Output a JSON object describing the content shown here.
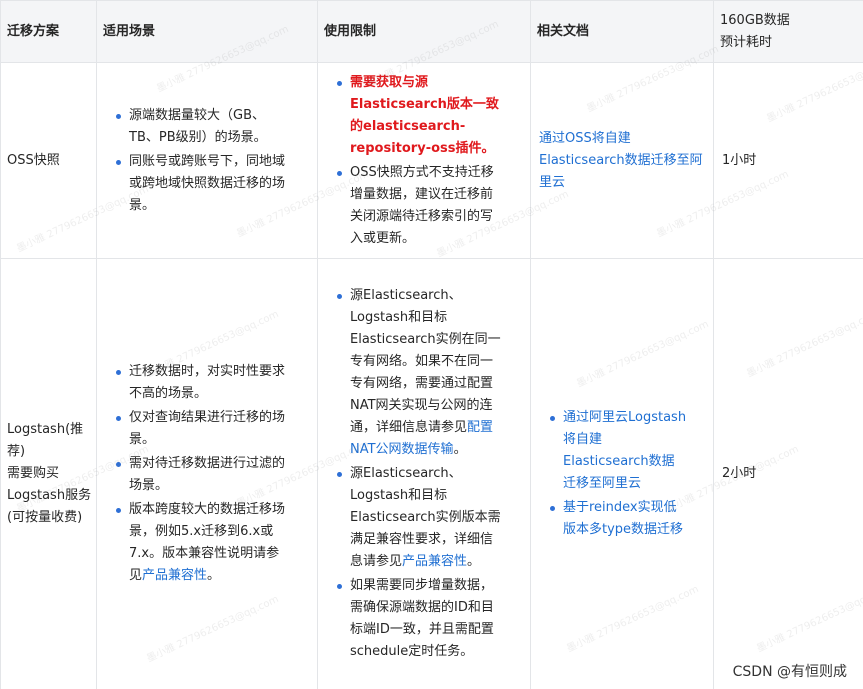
{
  "table": {
    "headers": {
      "scheme": "迁移方案",
      "scenario": "适用场景",
      "limits": "使用限制",
      "docs": "相关文档",
      "time_line1": "160GB数据",
      "time_line2": "预计耗时"
    },
    "rows": [
      {
        "scheme": "OSS快照",
        "scenarios": [
          "源端数据量较大（GB、TB、PB级别）的场景。",
          "同账号或跨账号下，同地域或跨地域快照数据迁移的场景。"
        ],
        "limits": [
          {
            "text": "需要获取与源Elasticsearch版本一致的elasticsearch-repository-oss插件。",
            "style": "red"
          },
          {
            "text": "OSS快照方式不支持迁移增量数据，建议在迁移前关闭源端待迁移索引的写入或更新。",
            "style": "normal"
          }
        ],
        "docs": "通过OSS将自建Elasticsearch数据迁移至阿里云",
        "time": "1小时"
      },
      {
        "scheme_line1": "Logstash(推荐)",
        "scheme_line2": "需要购买Logstash服务(可按量收费)",
        "scenarios": [
          "迁移数据时，对实时性要求不高的场景。",
          "仅对查询结果进行迁移的场景。",
          "需对待迁移数据进行过滤的场景。",
          "版本跨度较大的数据迁移场景，例如5.x迁移到6.x或7.x。版本兼容性说明请参见"
        ],
        "scenario4_link": "产品兼容性",
        "scenario4_tail": "。",
        "limit1_text": "源Elasticsearch、Logstash和目标Elasticsearch实例在同一专有网络。如果不在同一专有网络，需要通过配置NAT网关实现与公网的连通，详细信息请参见",
        "limit1_link": "配置NAT公网数据传输",
        "limit1_tail": "。",
        "limit2_text": "源Elasticsearch、Logstash和目标Elasticsearch实例版本需满足兼容性要求，详细信息请参见",
        "limit2_link": "产品兼容性",
        "limit2_tail": "。",
        "limit3_text": "如果需要同步增量数据，需确保源端数据的ID和目标端ID一致，并且需配置schedule定时任务。",
        "docs": [
          "通过阿里云Logstash将自建Elasticsearch数据迁移至阿里云",
          "基于reindex实现低版本多type数据迁移"
        ],
        "time": "2小时"
      }
    ]
  },
  "watermark": {
    "text": "墨小雅 2779626653@qq.com"
  },
  "footer": {
    "text": "CSDN @有恒则成"
  },
  "colors": {
    "header_bg": "#f4f5f7",
    "border": "#e3e5e8",
    "link": "#1f6fd2",
    "warning": "#e0191d",
    "bullet": "#2e6fd6"
  }
}
